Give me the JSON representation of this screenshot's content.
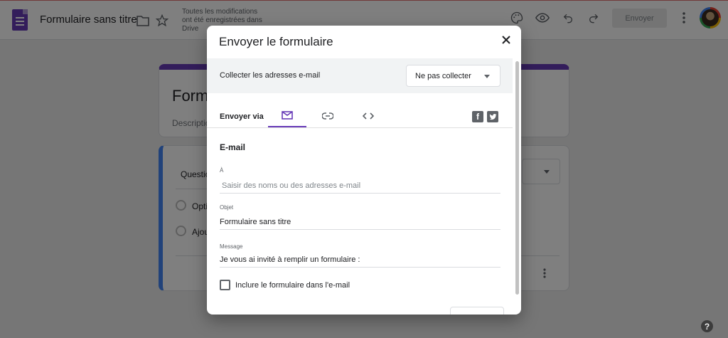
{
  "app": {
    "title": "Formulaire sans titre",
    "save_status": "Toutes les modifications ont été enregistrées dans Drive",
    "send_button": "Envoyer"
  },
  "form": {
    "title_partial": "Form",
    "description_partial": "Descriptio",
    "question_partial": "Questio",
    "option_partial": "Optio",
    "add_option_partial": "Ajout"
  },
  "dialog": {
    "title": "Envoyer le formulaire",
    "collect_label": "Collecter les adresses e-mail",
    "collect_value": "Ne pas collecter",
    "send_via_label": "Envoyer via",
    "tabs": [
      {
        "name": "email",
        "icon": "mail-icon",
        "active": true
      },
      {
        "name": "link",
        "icon": "link-icon",
        "active": false
      },
      {
        "name": "embed",
        "icon": "code-icon",
        "active": false
      }
    ],
    "social": [
      "facebook-icon",
      "twitter-icon"
    ],
    "section_title": "E-mail",
    "to_label": "À",
    "to_placeholder": "Saisir des noms ou des adresses e-mail",
    "subject_label": "Objet",
    "subject_value": "Formulaire sans titre",
    "message_label": "Message",
    "message_value": "Je vous ai invité à remplir un formulaire :",
    "include_label": "Inclure le formulaire dans l'e-mail"
  },
  "colors": {
    "accent": "#673ab7",
    "overlay": "rgba(0,0,0,0.5)"
  }
}
